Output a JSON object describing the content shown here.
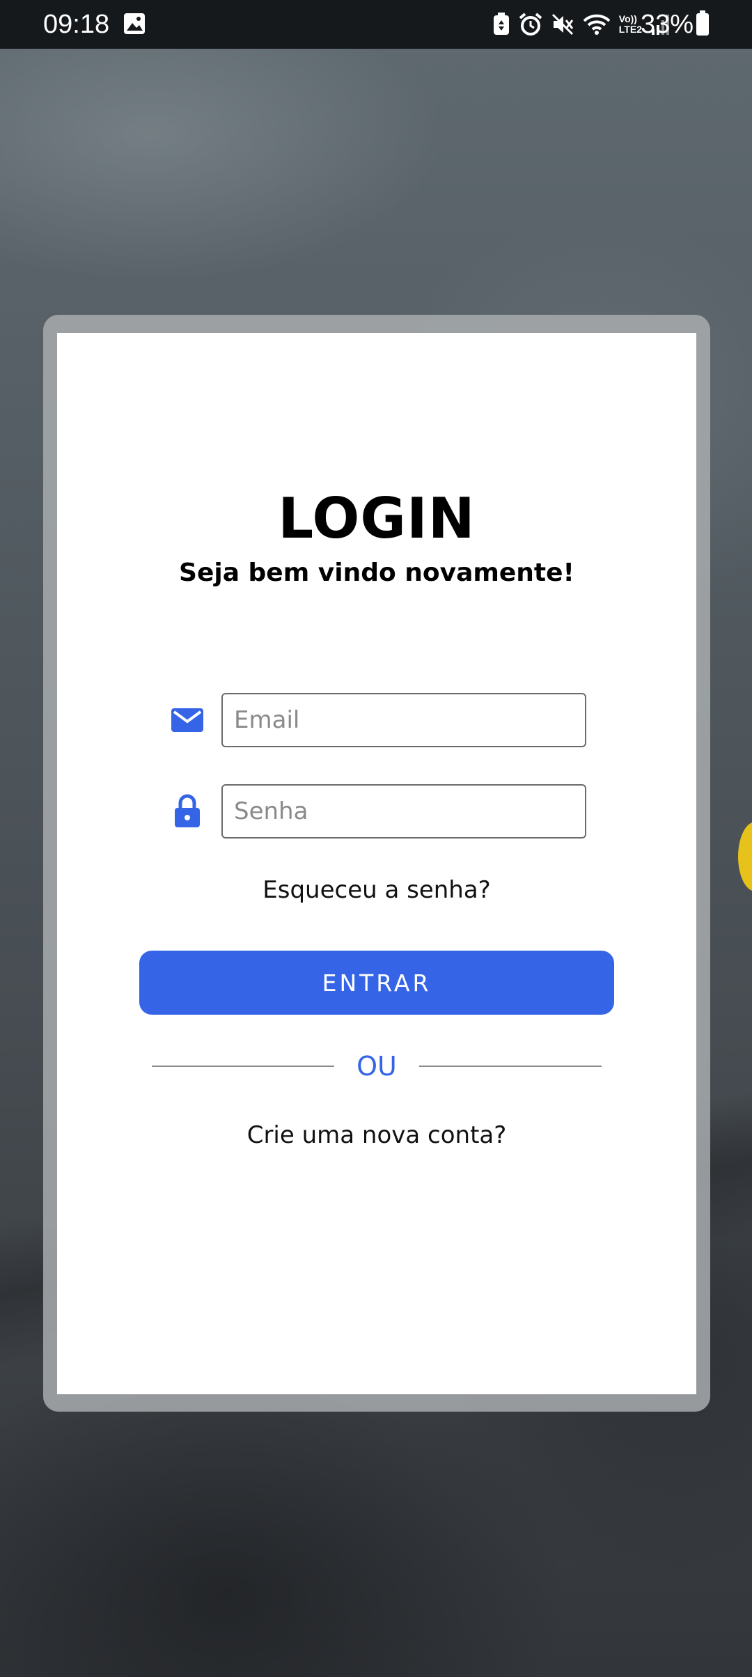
{
  "status_bar": {
    "time": "09:18",
    "battery_percent": "33%",
    "icons": [
      "image-icon",
      "battery-saver-icon",
      "alarm-icon",
      "mute-icon",
      "wifi-icon",
      "volte-lte2-icon",
      "signal-icon",
      "battery-icon"
    ],
    "network_label_top": "Vo))",
    "network_label_bottom": "LTE2"
  },
  "login": {
    "title": "LOGIN",
    "subtitle": "Seja bem vindo novamente!",
    "email_placeholder": "Email",
    "email_value": "",
    "password_placeholder": "Senha",
    "password_value": "",
    "forgot_password": "Esqueceu a senha?",
    "enter_button": "ENTRAR",
    "divider": "OU",
    "create_account": "Crie uma nova conta?"
  },
  "colors": {
    "accent": "#3565e6",
    "card_background": "#ffffff",
    "status_bar": "#16191c"
  }
}
